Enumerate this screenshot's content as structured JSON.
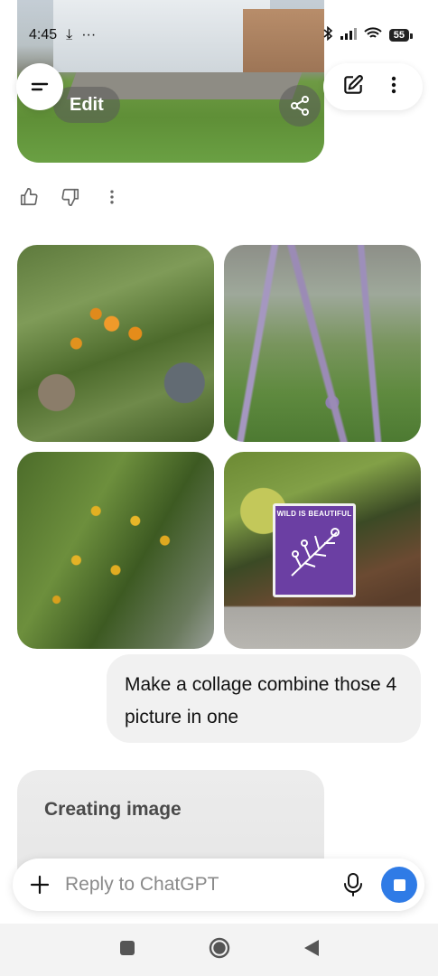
{
  "status_bar": {
    "time": "4:45",
    "battery": "55",
    "icons": [
      "download-icon",
      "more-dots-icon",
      "bluetooth-icon",
      "signal-icon",
      "wifi-icon",
      "battery-icon"
    ]
  },
  "header": {
    "menu_icon": "menu-icon",
    "new_chat_icon": "edit-icon",
    "more_icon": "more-vertical-icon"
  },
  "previous_image": {
    "edit_label": "Edit",
    "share_icon": "share-icon"
  },
  "feedback": {
    "icons": [
      "thumbs-up-icon",
      "thumbs-down-icon",
      "more-vertical-icon"
    ]
  },
  "photos": {
    "sign_text": "WILD IS BEAUTIFUL"
  },
  "user_message": {
    "text": "Make a collage combine those 4 picture in one"
  },
  "assistant": {
    "status": "Creating image"
  },
  "composer": {
    "placeholder": "Reply to ChatGPT",
    "value": ""
  },
  "nav_bar": {
    "icons": [
      "recents-icon",
      "home-icon",
      "back-icon"
    ]
  },
  "colors": {
    "accent": "#2f7be6",
    "bubble": "#f1f1f1",
    "sign_purple": "#6b3fa3"
  }
}
